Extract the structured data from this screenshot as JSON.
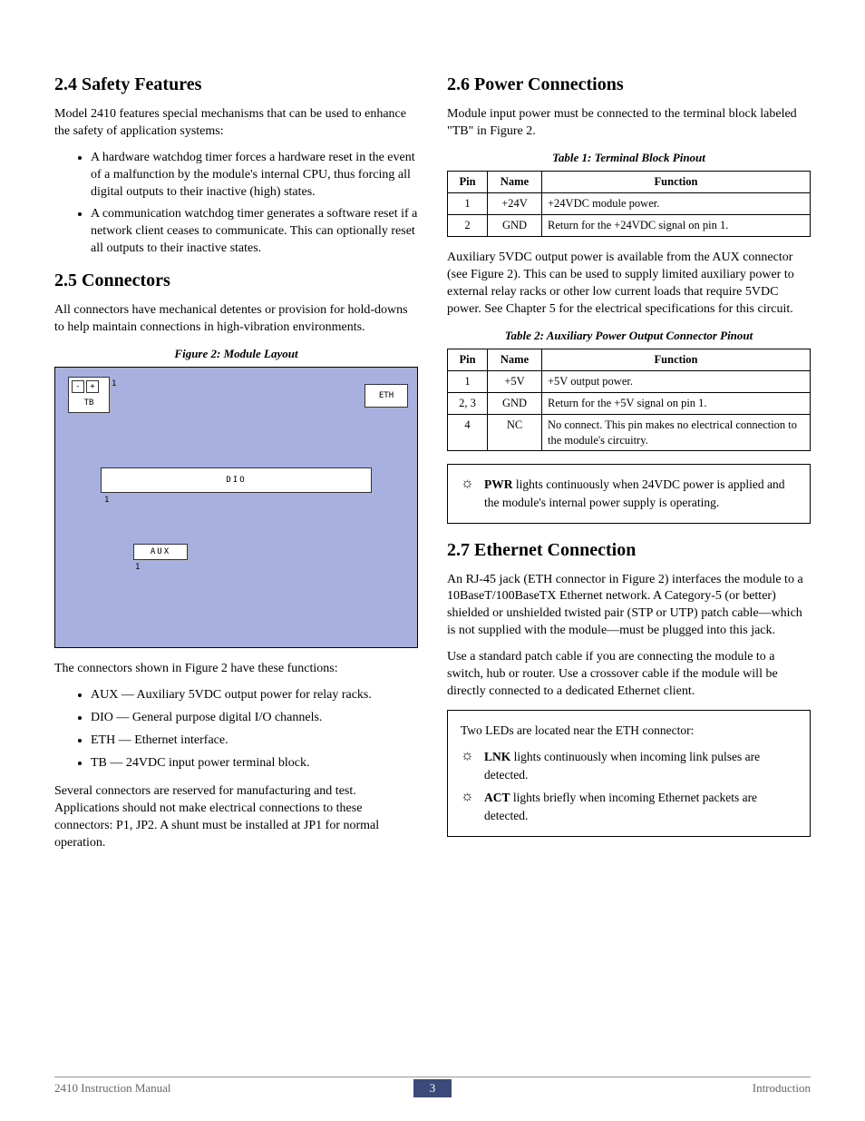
{
  "left": {
    "s24": {
      "heading": "2.4  Safety Features",
      "intro": "Model 2410 features special mechanisms that can be used to enhance the safety of application systems:",
      "bullets": [
        "A hardware watchdog timer forces a hardware reset in the event of a malfunction by the module's internal CPU, thus forcing all digital outputs to their inactive (high) states.",
        "A communication watchdog timer generates a software reset if a network client ceases to communicate. This can optionally reset all outputs to their inactive states."
      ]
    },
    "s25": {
      "heading": "2.5  Connectors",
      "intro": "All connectors have mechanical detentes or provision for hold-downs to help maintain connections in high-vibration environments.",
      "fig_caption": "Figure 2:  Module Layout",
      "diagram": {
        "tb_minus": "-",
        "tb_plus": "+",
        "tb_label": "TB",
        "pin1": "1",
        "eth": "ETH",
        "dio": "DIO",
        "aux": "AUX"
      },
      "after_fig": "The connectors shown in Figure 2 have these functions:",
      "conn_bullets": [
        "AUX — Auxiliary 5VDC output power for relay racks.",
        "DIO — General purpose digital I/O channels.",
        "ETH — Ethernet interface.",
        "TB — 24VDC input power terminal block."
      ],
      "reserved": "Several connectors are reserved for manufacturing and test. Applications should not make electrical connections to these connectors: P1, JP2. A shunt must be installed at JP1 for normal operation."
    }
  },
  "right": {
    "s26": {
      "heading": "2.6  Power Connections",
      "intro": "Module input power must be connected to the terminal block labeled \"TB\" in Figure 2.",
      "table1": {
        "caption": "Table 1: Terminal Block Pinout",
        "headers": [
          "Pin",
          "Name",
          "Function"
        ],
        "rows": [
          [
            "1",
            "+24V",
            "+24VDC module power."
          ],
          [
            "2",
            "GND",
            "Return for the +24VDC signal on pin 1."
          ]
        ]
      },
      "aux_text": "Auxiliary 5VDC output power is available from the AUX connector (see Figure 2). This can be used to supply limited auxiliary power to external relay racks or other low current loads that require 5VDC power. See Chapter 5 for the electrical specifications for this circuit.",
      "table2": {
        "caption": "Table 2: Auxiliary Power Output Connector Pinout",
        "headers": [
          "Pin",
          "Name",
          "Function"
        ],
        "rows": [
          [
            "1",
            "+5V",
            "+5V output power."
          ],
          [
            "2, 3",
            "GND",
            "Return for the +5V signal on pin 1."
          ],
          [
            "4",
            "NC",
            "No connect. This pin makes no electrical connection to the module's circuitry."
          ]
        ]
      },
      "pwr_note_bold": "PWR",
      "pwr_note_rest": " lights continuously when 24VDC power is applied and the module's internal power supply is operating."
    },
    "s27": {
      "heading": "2.7  Ethernet Connection",
      "p1": "An RJ-45 jack (ETH connector in Figure 2) interfaces the module to a 10BaseT/100BaseTX Ethernet network. A Category-5 (or better) shielded or unshielded twisted pair (STP or UTP) patch cable—which is not supplied with the module—must be plugged into this jack.",
      "p2": "Use a standard patch cable if you are connecting the module to a switch, hub or router. Use a crossover cable if the module will be directly connected to a dedicated Ethernet client.",
      "led_intro": "Two LEDs are located near the ETH connector:",
      "lnk_bold": "LNK",
      "lnk_rest": " lights continuously when incoming link pulses are detected.",
      "act_bold": "ACT",
      "act_rest": " lights briefly when incoming Ethernet packets are detected."
    }
  },
  "footer": {
    "left": "2410 Instruction Manual",
    "page": "3",
    "right": "Introduction"
  }
}
